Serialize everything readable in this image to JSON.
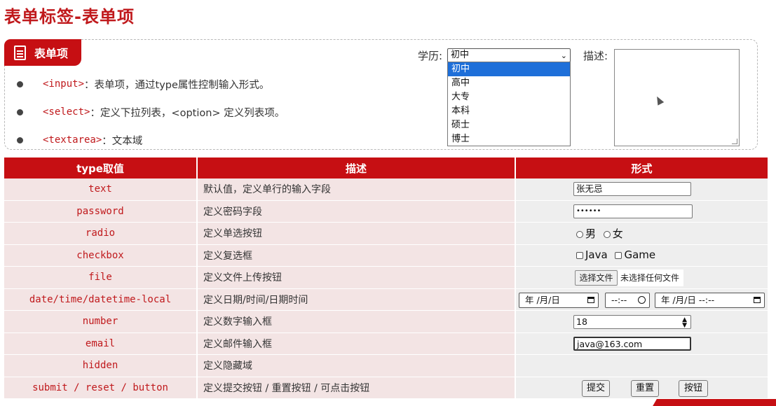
{
  "page_title": "表单标签-表单项",
  "badge_label": "表单项",
  "bullets": [
    {
      "code": "<input>",
      "desc": "：表单项，通过type属性控制输入形式。"
    },
    {
      "code": "<select>",
      "desc": "：定义下拉列表，<option> 定义列表项。"
    },
    {
      "code": "<textarea>",
      "desc": "：文本域"
    }
  ],
  "education": {
    "label": "学历:",
    "selected": "初中",
    "options": [
      "初中",
      "高中",
      "大专",
      "本科",
      "硕士",
      "博士"
    ]
  },
  "description_field": {
    "label": "描述:"
  },
  "table": {
    "headers": [
      "type取值",
      "描述",
      "形式"
    ],
    "rows": [
      {
        "type": "text",
        "desc": "默认值，定义单行的输入字段"
      },
      {
        "type": "password",
        "desc": "定义密码字段"
      },
      {
        "type": "radio",
        "desc": "定义单选按钮"
      },
      {
        "type": "checkbox",
        "desc": "定义复选框"
      },
      {
        "type": "file",
        "desc": "定义文件上传按钮"
      },
      {
        "type": "date/time/datetime-local",
        "desc": "定义日期/时间/日期时间"
      },
      {
        "type": "number",
        "desc": "定义数字输入框"
      },
      {
        "type": "email",
        "desc": "定义邮件输入框"
      },
      {
        "type": "hidden",
        "desc": "定义隐藏域"
      },
      {
        "type": "submit / reset / button",
        "desc": "定义提交按钮 / 重置按钮 / 可点击按钮"
      }
    ]
  },
  "demo": {
    "text_value": "张无忌",
    "password_value": "••••••",
    "radio_options": [
      "男",
      "女"
    ],
    "checkbox_options": [
      "Java",
      "Game"
    ],
    "file_button": "选择文件",
    "file_status": "未选择任何文件",
    "date_value": "年 /月/日",
    "time_value": "--:--",
    "datetime_value": "年 /月/日 --:--",
    "number_value": "18",
    "email_value": "java@163.com",
    "buttons": [
      "提交",
      "重置",
      "按钮"
    ]
  },
  "colors": {
    "accent": "#c60f13",
    "row_bg": "#f3e4e4",
    "select_highlight": "#1e6fd9"
  }
}
